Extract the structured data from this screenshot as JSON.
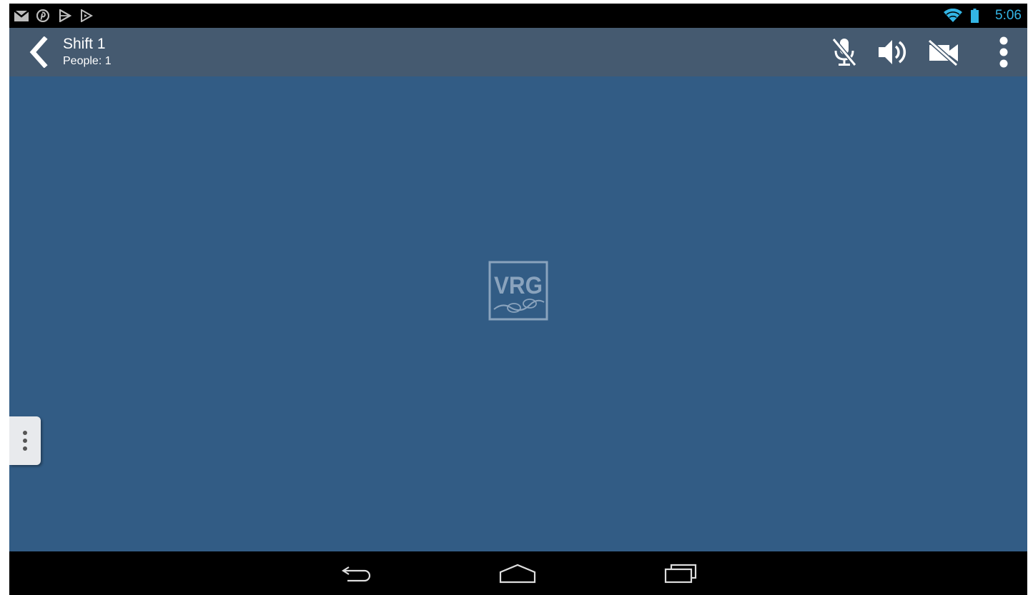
{
  "status_bar": {
    "time": "5:06",
    "notification_icons": [
      "gmail-icon",
      "pinterest-icon",
      "play-store-icon",
      "play-music-icon"
    ],
    "system_icons": [
      "wifi-icon",
      "battery-icon"
    ],
    "accent_color": "#33b5e5"
  },
  "action_bar": {
    "title": "Shift 1",
    "subtitle": "People: 1",
    "background": "#455a70",
    "actions": [
      "mic-off-icon",
      "speaker-icon",
      "video-off-icon",
      "overflow-menu-icon"
    ]
  },
  "main": {
    "background": "#325c85",
    "logo_text": "VRG"
  },
  "nav_bar": {
    "buttons": [
      "back-nav-icon",
      "home-nav-icon",
      "recents-nav-icon"
    ]
  }
}
